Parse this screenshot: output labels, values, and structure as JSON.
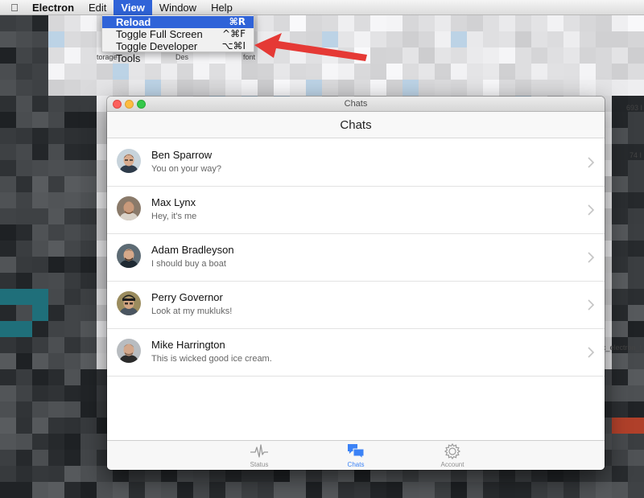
{
  "menubar": {
    "apple_icon": "apple-icon",
    "items": [
      {
        "label": "Electron"
      },
      {
        "label": "Edit"
      },
      {
        "label": "View"
      },
      {
        "label": "Window"
      },
      {
        "label": "Help"
      }
    ]
  },
  "view_menu": {
    "items": [
      {
        "label": "Reload",
        "shortcut": "⌘R"
      },
      {
        "label": "Toggle Full Screen",
        "shortcut": "^⌘F"
      },
      {
        "label": "Toggle Developer Tools",
        "shortcut": "⌥⌘I"
      }
    ]
  },
  "background_text": {
    "storage": "torage",
    "des": "Des",
    "font": "font",
    "size1": "693 I",
    "size2": "74 I",
    "filename": "c_electron_t"
  },
  "window": {
    "title": "Chats",
    "navbar_title": "Chats"
  },
  "chats": [
    {
      "name": "Ben Sparrow",
      "message": "You on your way?"
    },
    {
      "name": "Max Lynx",
      "message": "Hey, it's me"
    },
    {
      "name": "Adam Bradleyson",
      "message": "I should buy a boat"
    },
    {
      "name": "Perry Governor",
      "message": "Look at my mukluks!"
    },
    {
      "name": "Mike Harrington",
      "message": "This is wicked good ice cream."
    }
  ],
  "tabs": [
    {
      "label": "Status",
      "icon": "pulse-icon"
    },
    {
      "label": "Chats",
      "icon": "chat-bubbles-icon"
    },
    {
      "label": "Account",
      "icon": "gear-icon"
    }
  ],
  "colors": {
    "accent": "#3b82f6",
    "menu_highlight": "#2f63d8",
    "arrow": "#e53935"
  }
}
